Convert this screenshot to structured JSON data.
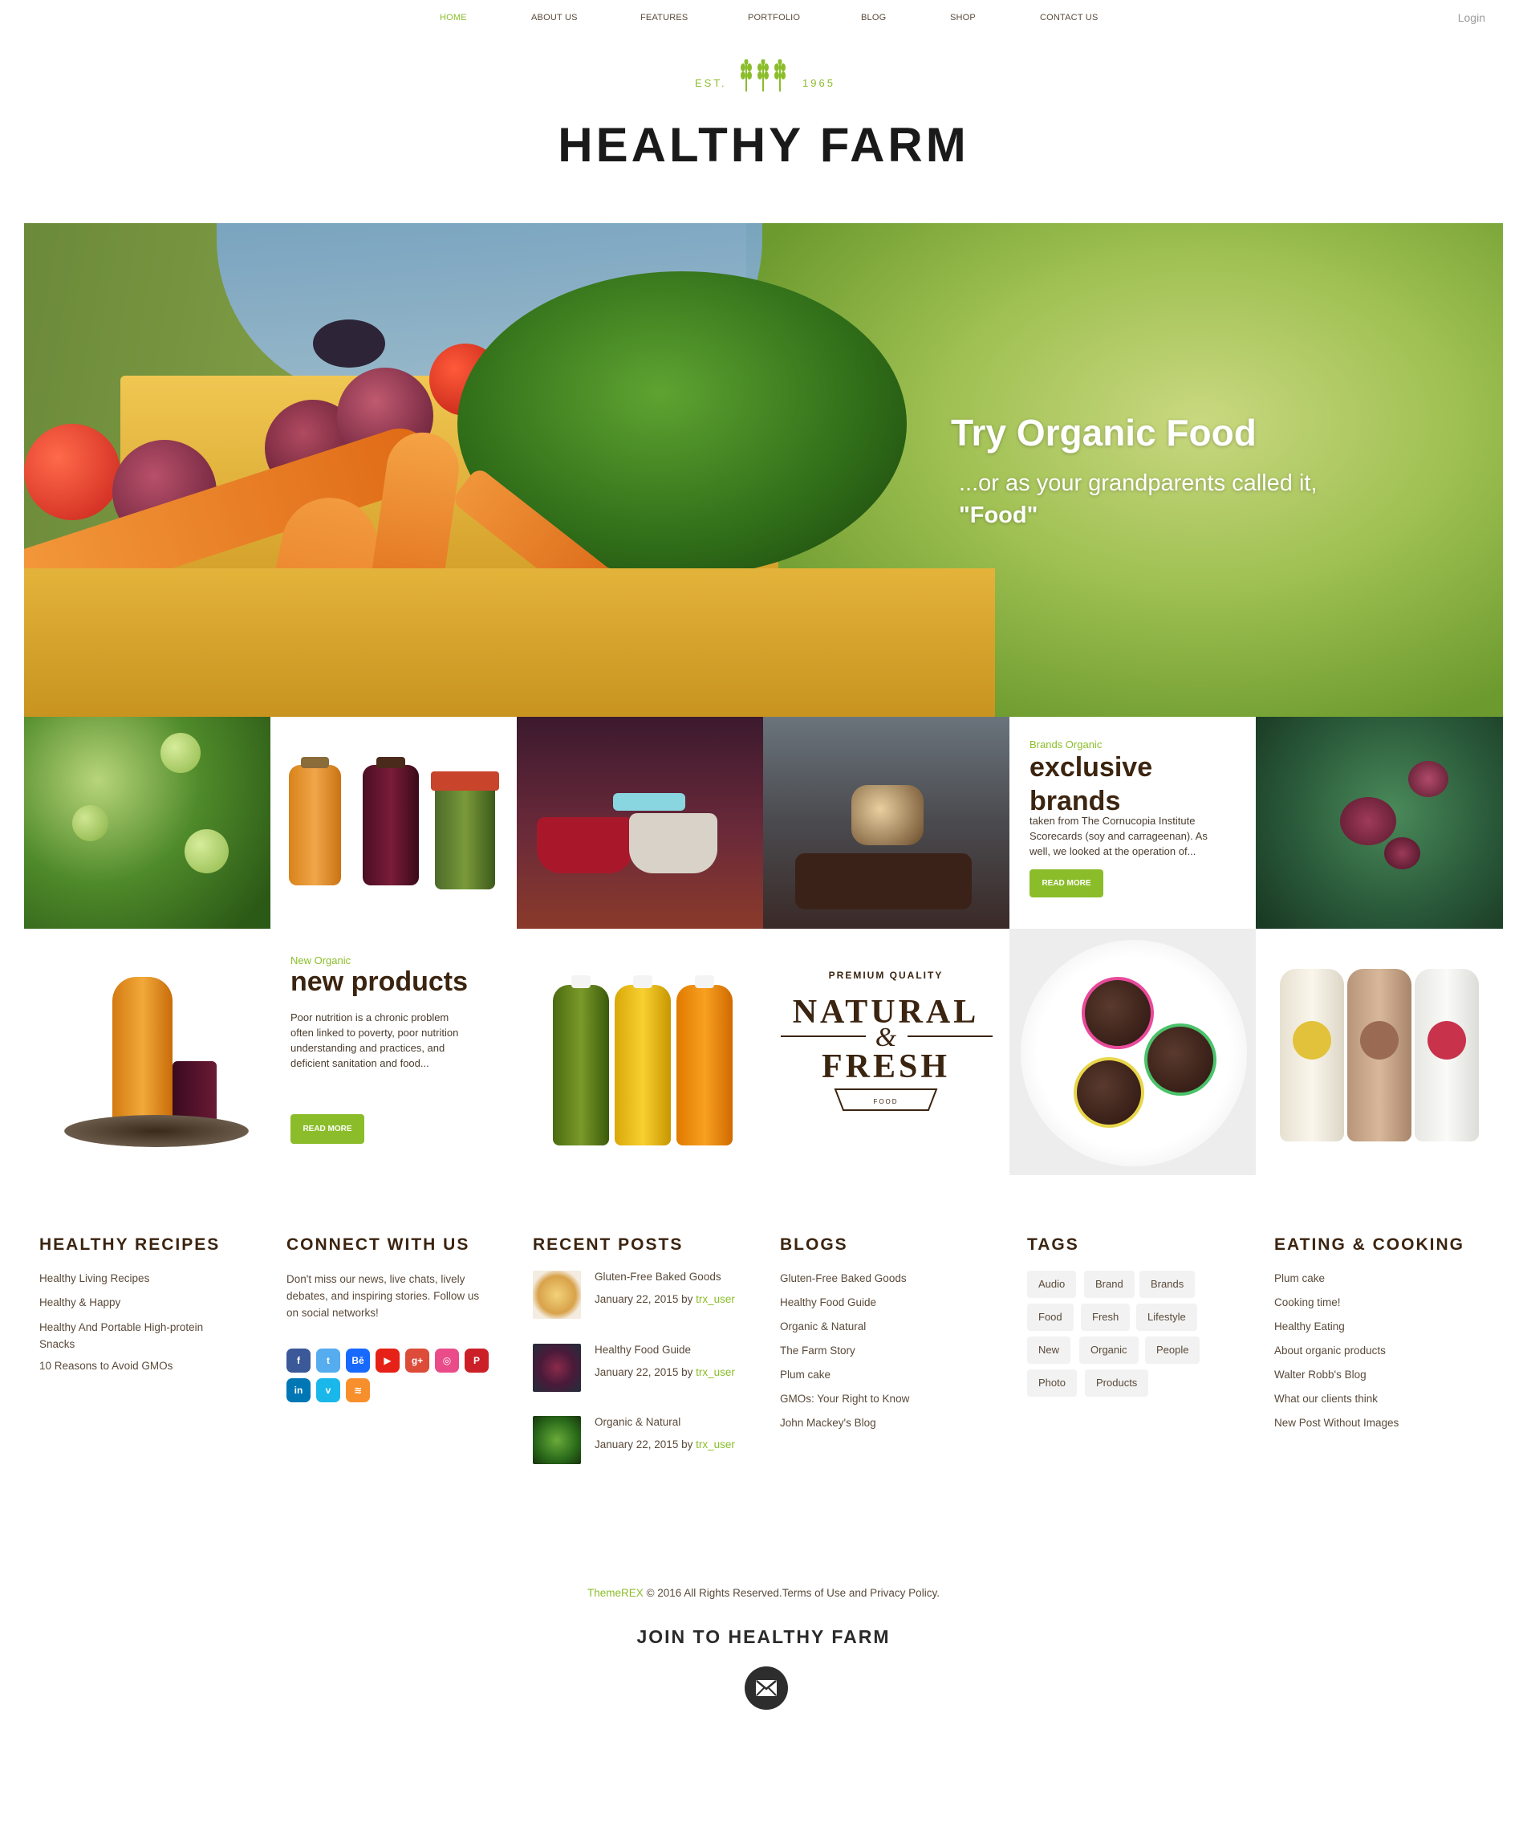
{
  "nav": {
    "items": [
      "HOME",
      "ABOUT US",
      "FEATURES",
      "PORTFOLIO",
      "BLOG",
      "SHOP",
      "CONTACT US"
    ],
    "active": "HOME",
    "login": "Login"
  },
  "logo": {
    "est": "EST.",
    "year": "1965",
    "title": "HEALTHY FARM"
  },
  "hero": {
    "title": "Try Organic Food",
    "subtitle": "...or as your grandparents called it,",
    "subtitle_bold": "\"Food\""
  },
  "promo_brands": {
    "kicker": "Brands Organic",
    "title_line1": "exclusive",
    "title_line2": "brands",
    "text_line1": "taken from The Cornucopia Institute",
    "text_line2": "Scorecards (soy and carrageenan). As",
    "text_line3": "well, we looked at the operation of...",
    "button": "READ MORE"
  },
  "promo_products": {
    "kicker": "New Organic",
    "title": "new products",
    "text_line1": "Poor nutrition is a chronic problem",
    "text_line2": "often linked to poverty, poor nutrition",
    "text_line3": "understanding and practices, and",
    "text_line4": "deficient sanitation and food...",
    "button": "READ MORE"
  },
  "natural_fresh": {
    "premium": "PREMIUM QUALITY",
    "natural": "NATURAL",
    "amp": "&",
    "fresh": "FRESH",
    "food": "FOOD"
  },
  "widgets": {
    "recipes": {
      "title": "HEALTHY RECIPES",
      "items": [
        "Healthy Living Recipes",
        "Healthy & Happy",
        "Healthy And Portable High-protein",
        "Snacks",
        "10 Reasons to Avoid GMOs"
      ]
    },
    "connect": {
      "title": "CONNECT WITH US",
      "text_line1": "Don't miss our news, live chats, lively",
      "text_line2": "debates, and inspiring stories. Follow us",
      "text_line3": "on social networks!"
    },
    "recent": {
      "title": "RECENT POSTS",
      "posts": [
        {
          "title": "Gluten-Free Baked Goods",
          "date": "January 22, 2015 by",
          "author": "trx_user"
        },
        {
          "title": "Healthy Food Guide",
          "date": "January 22, 2015 by",
          "author": "trx_user"
        },
        {
          "title": "Organic & Natural",
          "date": "January 22, 2015 by",
          "author": "trx_user"
        }
      ]
    },
    "blogs": {
      "title": "BLOGS",
      "items": [
        "Gluten-Free Baked Goods",
        "Healthy Food Guide",
        "Organic & Natural",
        "The Farm Story",
        "Plum cake",
        "GMOs: Your Right to Know",
        "John Mackey's Blog"
      ]
    },
    "tags": {
      "title": "TAGS",
      "items": [
        "Audio",
        "Brand",
        "Brands",
        "Food",
        "Fresh",
        "Lifestyle",
        "New",
        "Organic",
        "People",
        "Photo",
        "Products"
      ]
    },
    "eating": {
      "title": "EATING & COOKING",
      "items": [
        "Plum cake",
        "Cooking time!",
        "Healthy Eating",
        "About organic products",
        "Walter Robb's Blog",
        "What our clients think",
        "New Post Without Images"
      ]
    }
  },
  "social_icons": [
    "facebook-icon",
    "twitter-icon",
    "behance-icon",
    "youtube-icon",
    "google-plus-icon",
    "dribbble-icon",
    "pinterest-icon",
    "linkedin-icon",
    "vimeo-icon",
    "rss-icon"
  ],
  "social_glyphs": [
    "f",
    "t",
    "Bē",
    "▶",
    "g+",
    "◎",
    "P",
    "in",
    "v",
    "≋"
  ],
  "social_colors": [
    "#3b5998",
    "#55acee",
    "#1769ff",
    "#e62117",
    "#dd4b39",
    "#ea4c89",
    "#cb2027",
    "#0077b5",
    "#1ab7ea",
    "#f7902c"
  ],
  "footer": {
    "brand": "ThemeREX",
    "copyright": " © 2016 All Rights Reserved.",
    "terms": "Terms of Use",
    "and": " and ",
    "privacy": "Privacy Policy.",
    "join": "JOIN TO HEALTHY FARM"
  },
  "colors": {
    "accent": "#8bbd2a",
    "heading": "#3b2410"
  }
}
